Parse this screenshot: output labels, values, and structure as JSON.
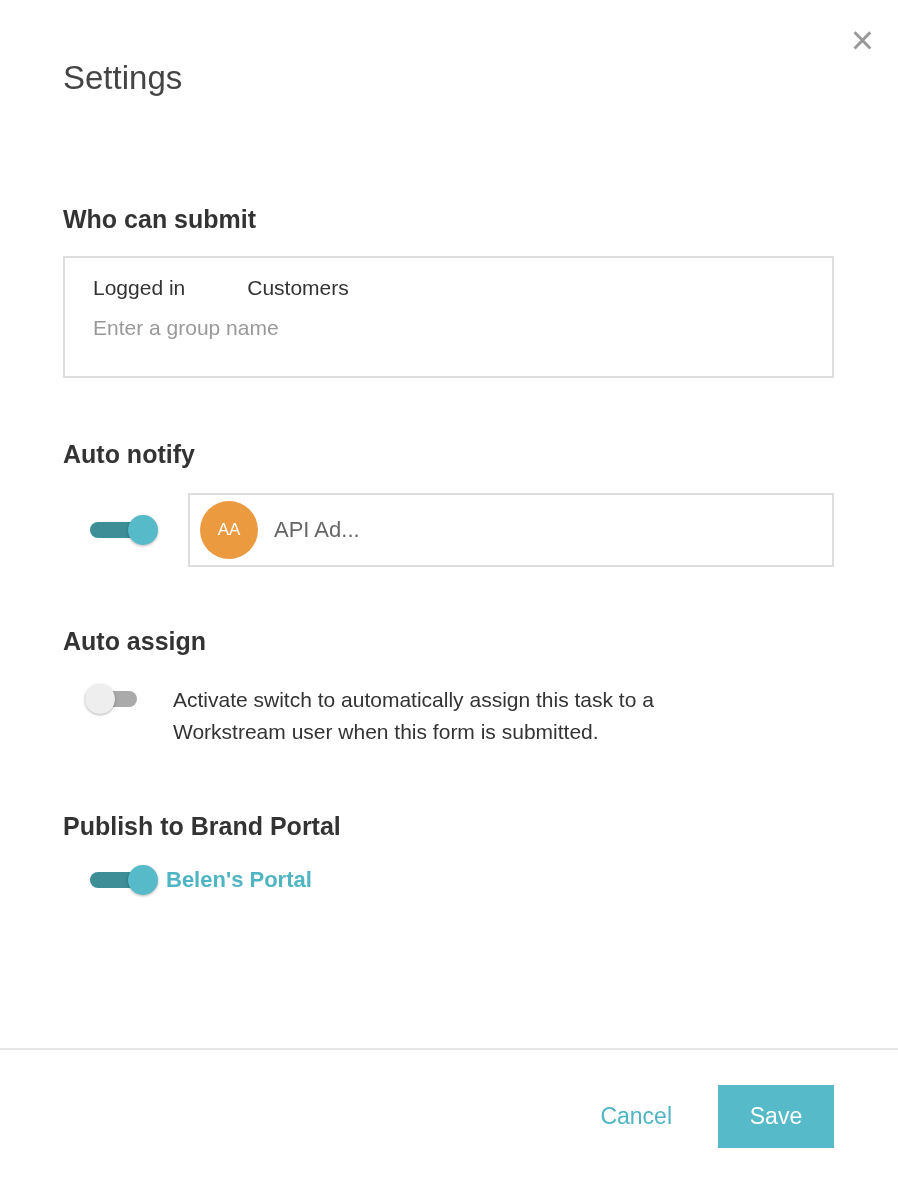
{
  "dialog": {
    "title": "Settings",
    "close_icon": "×"
  },
  "who_can_submit": {
    "heading": "Who can submit",
    "groups": [
      "Logged in",
      "Customers"
    ],
    "placeholder": "Enter a group name"
  },
  "auto_notify": {
    "heading": "Auto notify",
    "on": true,
    "avatar_initials": "AA",
    "user_name": "API Ad..."
  },
  "auto_assign": {
    "heading": "Auto assign",
    "on": false,
    "description": "Activate switch to automatically assign this task to a Workstream user when this form is submitted."
  },
  "publish": {
    "heading": "Publish to Brand Portal",
    "on": true,
    "portal": "Belen's Portal"
  },
  "buttons": {
    "cancel": "Cancel",
    "save": "Save"
  }
}
